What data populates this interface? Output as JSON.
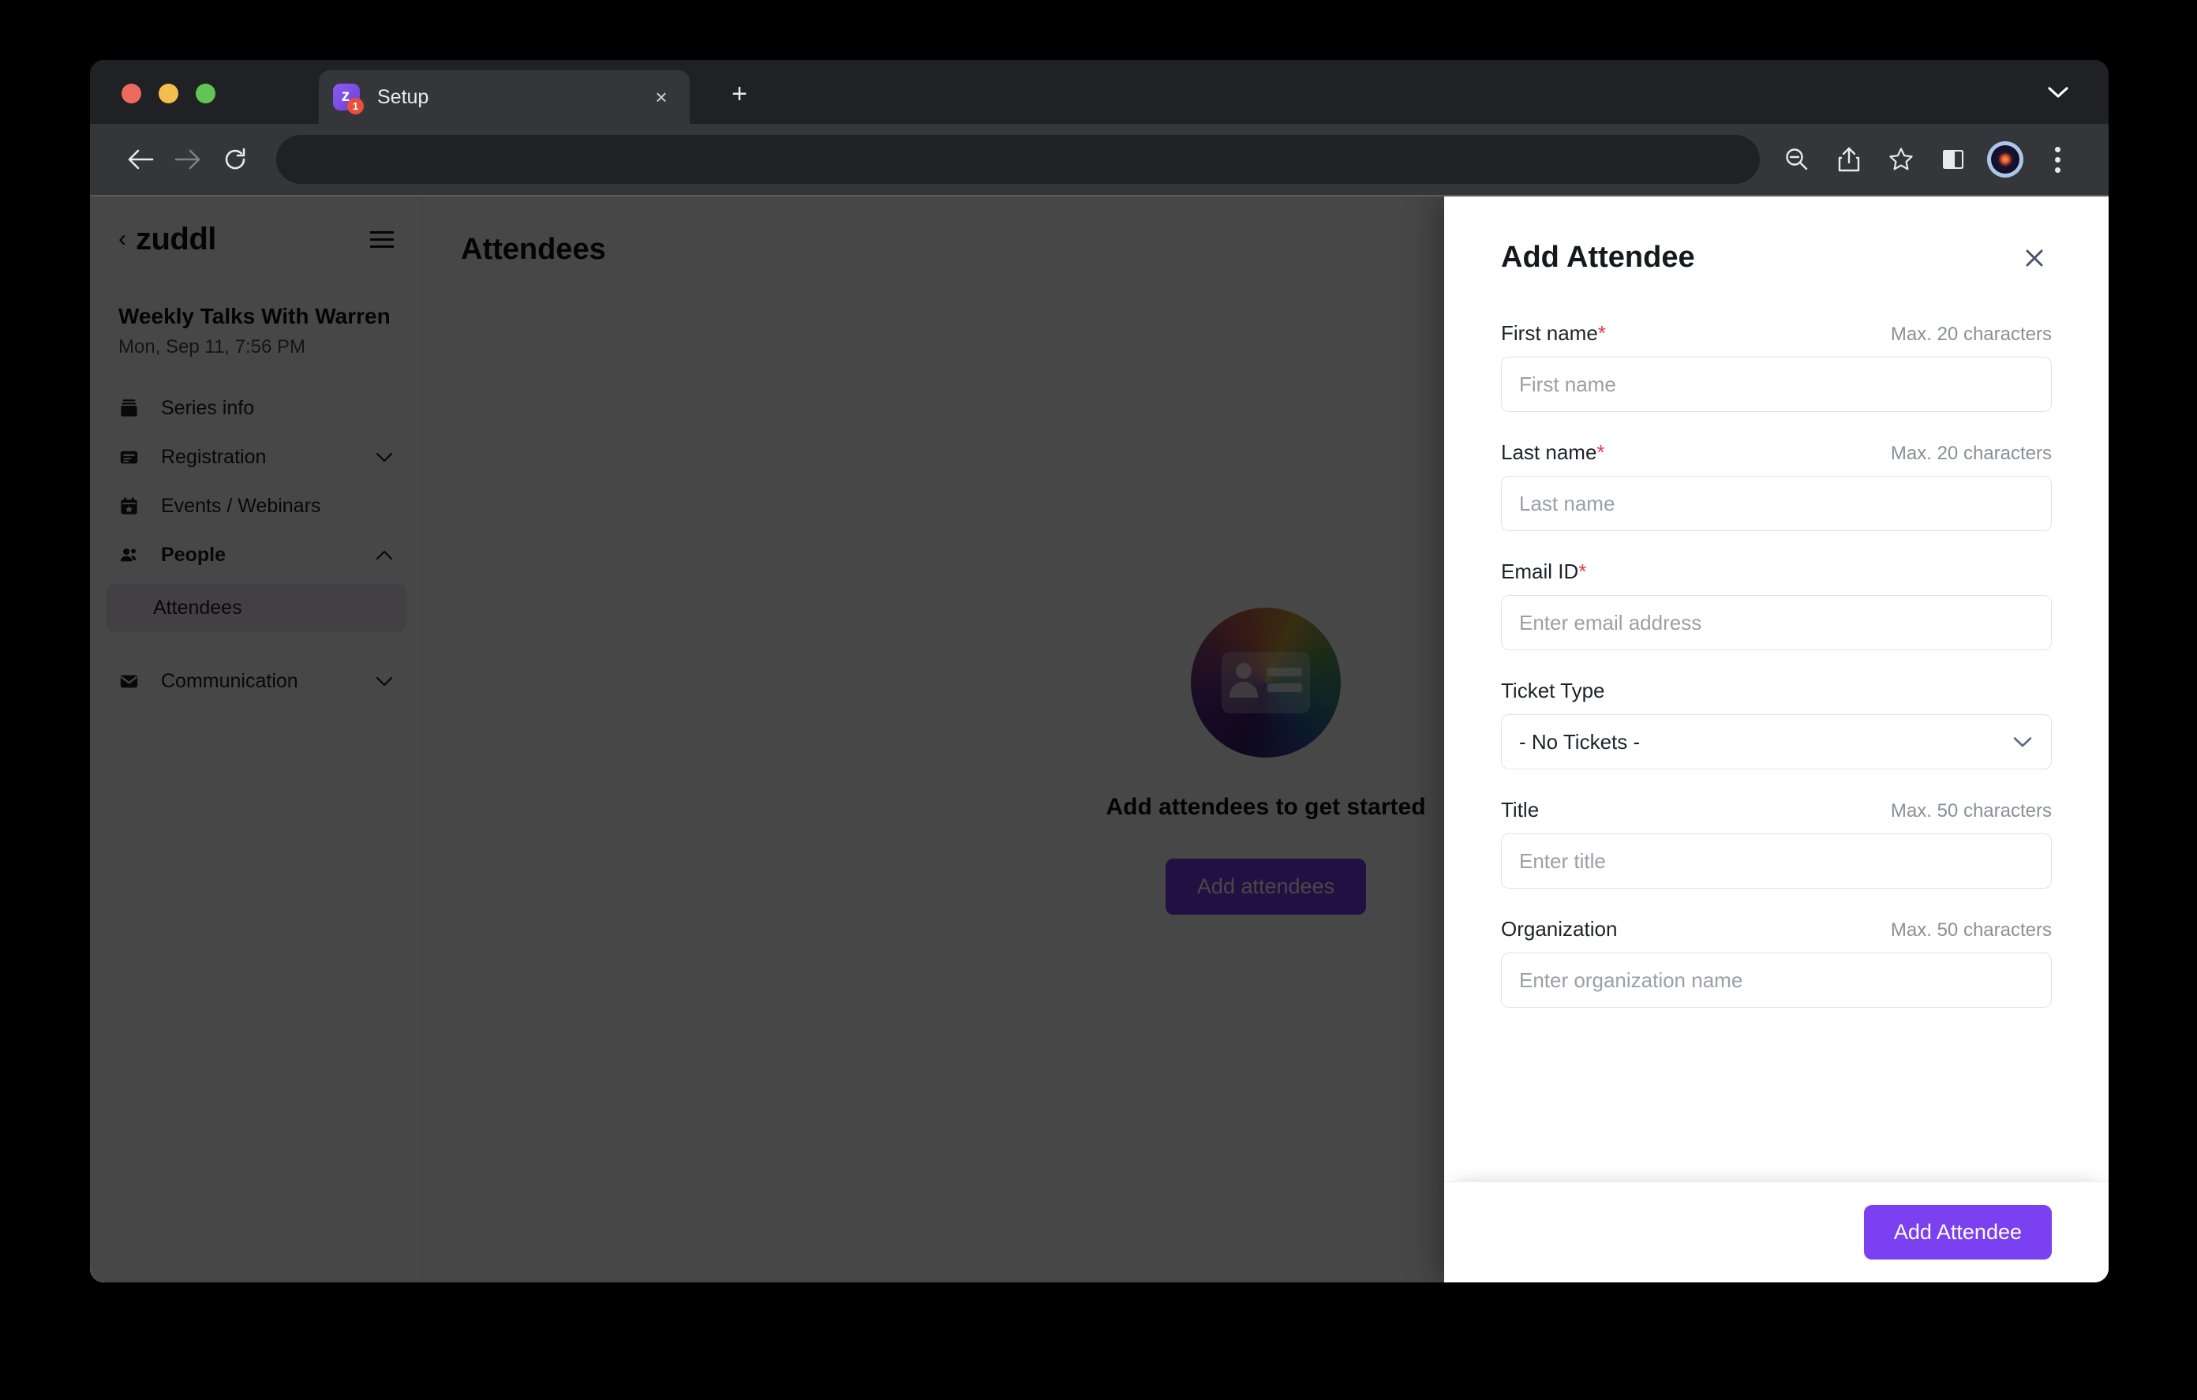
{
  "browser": {
    "tab": {
      "title": "Setup",
      "favicon_letter": "z",
      "badge_count": "1",
      "close_label": "×"
    },
    "new_tab_label": "+",
    "tabstrip_chevron_icon": "chevron-down-icon",
    "nav": {
      "back_icon": "back-arrow-icon",
      "forward_icon": "forward-arrow-icon",
      "reload_icon": "reload-icon"
    },
    "omnibox": {
      "value": "",
      "placeholder": ""
    },
    "actions": [
      {
        "name": "zoom-out-icon",
        "label": "Zoom out"
      },
      {
        "name": "share-icon",
        "label": "Share"
      },
      {
        "name": "bookmark-star-icon",
        "label": "Bookmark"
      },
      {
        "name": "side-panel-icon",
        "label": "Side panel"
      },
      {
        "name": "profile-avatar",
        "label": "Profile"
      },
      {
        "name": "more-menu-icon",
        "label": "Customize and control"
      }
    ]
  },
  "app": {
    "brand": {
      "back": "‹",
      "name": "zuddl"
    },
    "event": {
      "title": "Weekly Talks With Warren",
      "date": "Mon, Sep 11, 7:56 PM"
    },
    "sidebar": {
      "items": [
        {
          "label": "Series info",
          "icon": "archive-box-icon",
          "chevron": "",
          "active": false
        },
        {
          "label": "Registration",
          "icon": "registration-form-icon",
          "chevron": "⌄",
          "active": false
        },
        {
          "label": "Events / Webinars",
          "icon": "calendar-star-icon",
          "chevron": "",
          "active": false
        },
        {
          "label": "People",
          "icon": "people-icon",
          "chevron": "⌃",
          "active": true
        }
      ],
      "sub_item": {
        "label": "Attendees"
      },
      "communication": {
        "label": "Communication",
        "icon": "envelope-icon",
        "chevron": "⌄"
      }
    },
    "main": {
      "title": "Attendees",
      "empty_state": {
        "icon": "contact-card-gradient-icon",
        "text": "Add attendees to get started",
        "button_label": "Add attendees"
      }
    }
  },
  "drawer": {
    "title": "Add Attendee",
    "close_icon": "close-icon",
    "fields": [
      {
        "label": "First name",
        "required": true,
        "hint": "Max. 20 characters",
        "placeholder": "First name",
        "value": "",
        "type": "text",
        "name": "first-name"
      },
      {
        "label": "Last name",
        "required": true,
        "hint": "Max. 20 characters",
        "placeholder": "Last name",
        "value": "",
        "type": "text",
        "name": "last-name"
      },
      {
        "label": "Email ID",
        "required": true,
        "hint": "",
        "placeholder": "Enter email address",
        "value": "",
        "type": "email",
        "name": "email"
      },
      {
        "label": "Ticket Type",
        "required": false,
        "hint": "",
        "placeholder": "",
        "value": "- No Tickets -",
        "type": "select",
        "name": "ticket-type"
      },
      {
        "label": "Title",
        "required": false,
        "hint": "Max. 50 characters",
        "placeholder": "Enter title",
        "value": "",
        "type": "text",
        "name": "title"
      },
      {
        "label": "Organization",
        "required": false,
        "hint": "Max. 50 characters",
        "placeholder": "Enter organization name",
        "value": "",
        "type": "text",
        "name": "organization"
      }
    ],
    "ticket_type_options": [
      "- No Tickets -"
    ],
    "submit_label": "Add Attendee"
  },
  "colors": {
    "accent_purple": "#7b40ef",
    "required_red": "#e23b4a",
    "scrim": "rgba(0,0,0,0.72)"
  }
}
